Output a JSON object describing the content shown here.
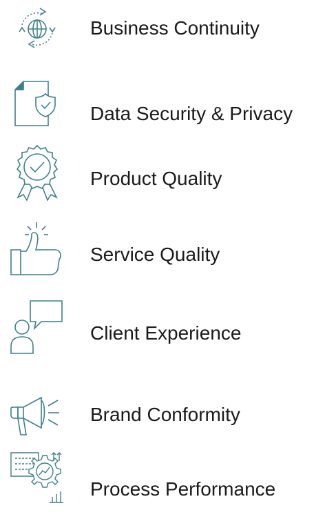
{
  "items": [
    {
      "label": "Business Continuity",
      "icon": "globe-cycle-icon"
    },
    {
      "label": "Data Security & Privacy",
      "icon": "document-shield-icon"
    },
    {
      "label": "Product Quality",
      "icon": "quality-badge-icon"
    },
    {
      "label": "Service Quality",
      "icon": "thumbs-up-icon"
    },
    {
      "label": "Client Experience",
      "icon": "person-speech-icon"
    },
    {
      "label": "Brand Conformity",
      "icon": "megaphone-icon"
    },
    {
      "label": "Process Performance",
      "icon": "process-gear-icon"
    }
  ],
  "colors": {
    "icon": "#3d7f8c",
    "text": "#1a1a1a",
    "background": "#ffffff"
  }
}
